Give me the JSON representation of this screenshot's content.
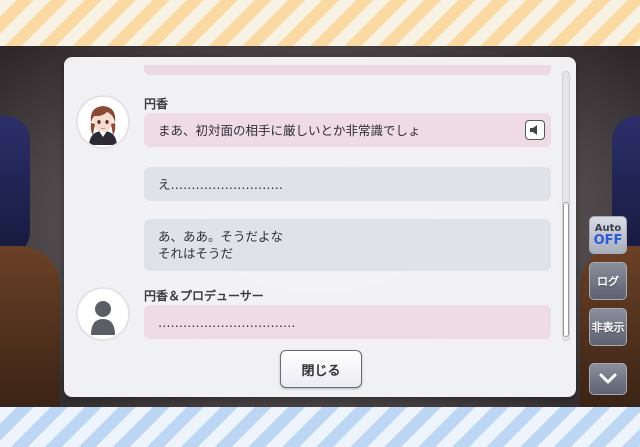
{
  "log": {
    "entries": [
      {
        "speaker": "円香",
        "text_lines": [
          "まあ、初対面の相手に厳しいとか非常識でしょ"
        ],
        "style": "pink",
        "avatar": "madoka-portrait",
        "has_voice": true
      },
      {
        "speaker": "",
        "text_lines": [
          "え………………………"
        ],
        "style": "gray",
        "avatar": "",
        "has_voice": false
      },
      {
        "speaker": "",
        "text_lines": [
          "あ、ああ。そうだよな",
          "それはそうだ"
        ],
        "style": "gray",
        "avatar": "",
        "has_voice": false
      },
      {
        "speaker": "円香＆プロデューサー",
        "text_lines": [
          "……………………………"
        ],
        "style": "pink",
        "avatar": "silhouette",
        "has_voice": false
      }
    ],
    "close_label": "閉じる"
  },
  "controls": {
    "auto_label": "Auto",
    "auto_state": "OFF",
    "log_label": "ログ",
    "hide_label": "非表示",
    "next_icon": "chevron-down-icon"
  },
  "colors": {
    "pink_bubble": "#efdbe4",
    "gray_bubble": "#dfe2e7",
    "auto_off": "#2a5ad7"
  }
}
